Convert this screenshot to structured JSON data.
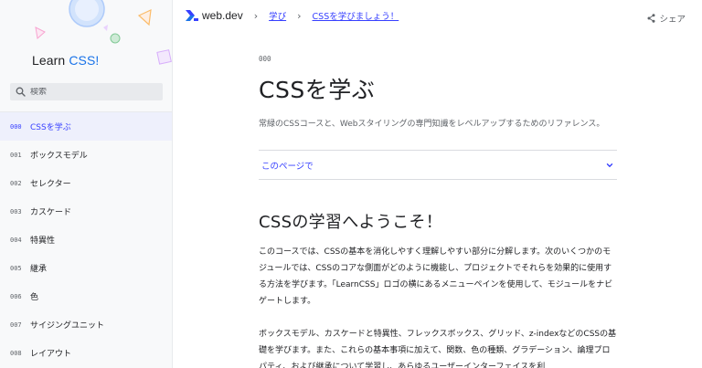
{
  "sidebar": {
    "logo": {
      "learn": "Learn",
      "css": "CSS",
      "bang": "!"
    },
    "search": {
      "placeholder": "検索",
      "value": ""
    },
    "items": [
      {
        "num": "000",
        "label": "CSSを学ぶ",
        "active": true
      },
      {
        "num": "001",
        "label": "ボックスモデル"
      },
      {
        "num": "002",
        "label": "セレクター"
      },
      {
        "num": "003",
        "label": "カスケード"
      },
      {
        "num": "004",
        "label": "特異性"
      },
      {
        "num": "005",
        "label": "継承"
      },
      {
        "num": "006",
        "label": "色"
      },
      {
        "num": "007",
        "label": "サイジングユニット"
      },
      {
        "num": "008",
        "label": "レイアウト"
      }
    ]
  },
  "topbar": {
    "brand": "web.dev",
    "breadcrumbs": [
      "学び",
      "CSSを学びましょう！"
    ],
    "share_label": "シェア"
  },
  "main": {
    "eyebrow": "000",
    "title": "CSSを学ぶ",
    "subtitle": "常緑のCSSコースと、Webスタイリングの専門知識をレベルアップするためのリファレンス。",
    "toc_label": "このページで",
    "heading": "CSSの学習へようこそ！",
    "paragraphs": [
      "このコースでは、CSSの基本を消化しやすく理解しやすい部分に分解します。次のいくつかのモジュールでは、CSSのコアな側面がどのように機能し、プロジェクトでそれらを効果的に使用する方法を学びます。「LearnCSS」ロゴの横にあるメニューペインを使用して、モジュールをナビゲートします。",
      "ボックスモデル、カスケードと特異性、フレックスボックス、グリッド、z-indexなどのCSSの基礎を学びます。また、これらの基本事項に加えて、関数、色の種類、グラデーション、論理プロパティ、および継承について学習し、あらゆるユーザーインターフェイスを利"
    ]
  },
  "colors": {
    "accent": "#3740ff",
    "sidebar_bg": "#f8f9fa",
    "active_bg": "#eef0fc"
  },
  "icons": {
    "search": "search-icon",
    "brand": "web-dev-logo-icon",
    "share": "share-icon",
    "toc": "chevron-down-icon"
  }
}
